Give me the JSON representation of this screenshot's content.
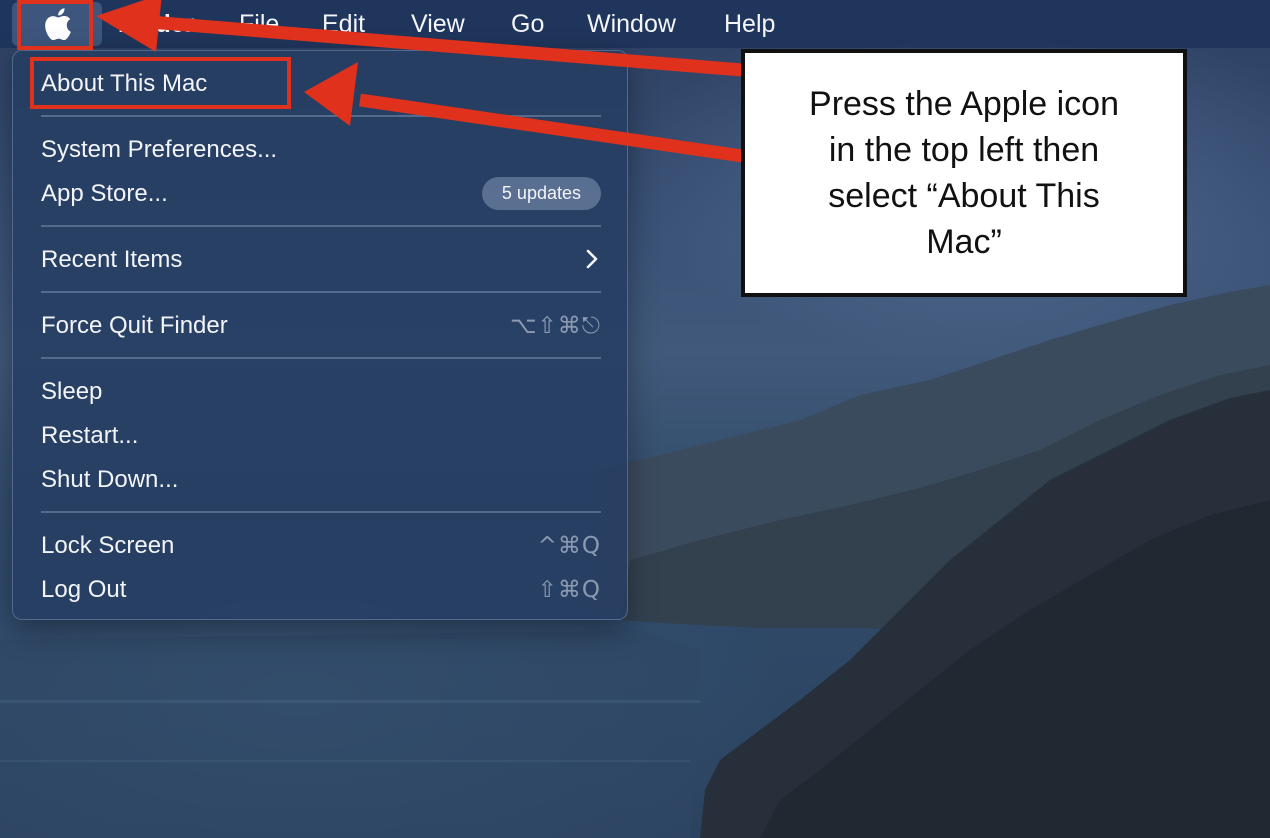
{
  "menubar": {
    "app_name": "Finder",
    "menus": [
      "File",
      "Edit",
      "View",
      "Go",
      "Window",
      "Help"
    ]
  },
  "apple_menu": {
    "about": "About This Mac",
    "system_preferences": "System Preferences...",
    "app_store": "App Store...",
    "app_store_badge": "5 updates",
    "recent_items": "Recent Items",
    "force_quit": "Force Quit Finder",
    "force_quit_shortcut": "⌥⇧⌘⎋",
    "sleep": "Sleep",
    "restart": "Restart...",
    "shut_down": "Shut Down...",
    "lock_screen": "Lock Screen",
    "lock_screen_shortcut": "^⌘Q",
    "log_out": "Log Out",
    "log_out_shortcut": "⇧⌘Q"
  },
  "annotation": {
    "callout_text": "Press the Apple icon in the top left then select “About This Mac”",
    "highlight_color": "#e0311c"
  },
  "icons": {
    "apple": "apple-logo-icon",
    "submenu": "chevron-right-icon"
  }
}
